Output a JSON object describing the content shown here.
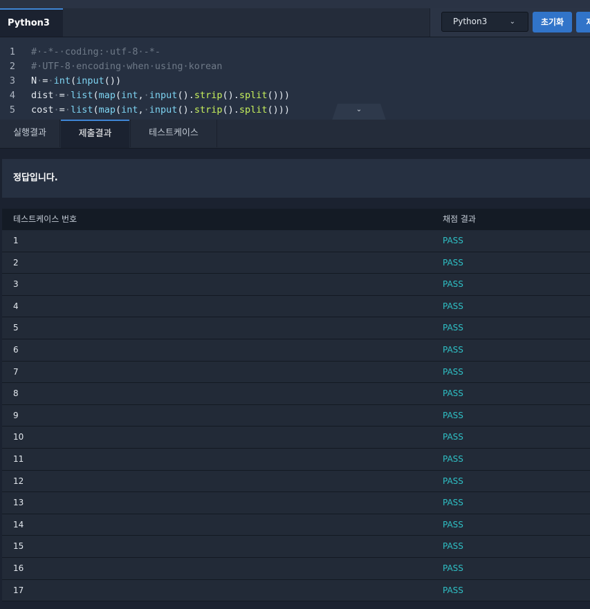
{
  "editor_tab": {
    "filename": "Python3"
  },
  "toolbar": {
    "language": "Python3",
    "reset_label": "초기화",
    "submit_label": "제"
  },
  "code_lines": [
    {
      "n": "1",
      "html": "<span class=\"cm\">#<span class=\"sp\">·</span>-*-<span class=\"sp\">·</span>coding:<span class=\"sp\">·</span>utf-8<span class=\"sp\">·</span>-*-</span>"
    },
    {
      "n": "2",
      "html": "<span class=\"cm\">#<span class=\"sp\">·</span>UTF-8<span class=\"sp\">·</span>encoding<span class=\"sp\">·</span>when<span class=\"sp\">·</span>using<span class=\"sp\">·</span>korean</span>"
    },
    {
      "n": "3",
      "html": "N<span class=\"sp\">·</span>=<span class=\"sp\">·</span><span class=\"fn\">int</span>(<span class=\"fn\">input</span>())"
    },
    {
      "n": "4",
      "html": "dist<span class=\"sp\">·</span>=<span class=\"sp\">·</span><span class=\"fn\">list</span>(<span class=\"fn\">map</span>(<span class=\"fn\">int</span>,<span class=\"sp\">·</span><span class=\"fn\">input</span>().<span class=\"mt\">strip</span>().<span class=\"mt\">split</span>()))"
    },
    {
      "n": "5",
      "html": "cost<span class=\"sp\">·</span>=<span class=\"sp\">·</span><span class=\"fn\">list</span>(<span class=\"fn\">map</span>(<span class=\"fn\">int</span>,<span class=\"sp\">·</span><span class=\"fn\">input</span>().<span class=\"mt\">strip</span>().<span class=\"mt\">split</span>()))"
    }
  ],
  "result_tabs": {
    "run": "실행결과",
    "submit": "제출결과",
    "testcases": "테스트케이스"
  },
  "result_message": "정답입니다.",
  "table": {
    "header": {
      "case_no": "테스트케이스 번호",
      "result": "채점 결과"
    },
    "rows": [
      {
        "n": "1",
        "r": "PASS"
      },
      {
        "n": "2",
        "r": "PASS"
      },
      {
        "n": "3",
        "r": "PASS"
      },
      {
        "n": "4",
        "r": "PASS"
      },
      {
        "n": "5",
        "r": "PASS"
      },
      {
        "n": "6",
        "r": "PASS"
      },
      {
        "n": "7",
        "r": "PASS"
      },
      {
        "n": "8",
        "r": "PASS"
      },
      {
        "n": "9",
        "r": "PASS"
      },
      {
        "n": "10",
        "r": "PASS"
      },
      {
        "n": "11",
        "r": "PASS"
      },
      {
        "n": "12",
        "r": "PASS"
      },
      {
        "n": "13",
        "r": "PASS"
      },
      {
        "n": "14",
        "r": "PASS"
      },
      {
        "n": "15",
        "r": "PASS"
      },
      {
        "n": "16",
        "r": "PASS"
      },
      {
        "n": "17",
        "r": "PASS"
      }
    ]
  },
  "colors": {
    "accent": "#3174c9",
    "pass": "#2fc1c6",
    "background": "#1b2230"
  }
}
